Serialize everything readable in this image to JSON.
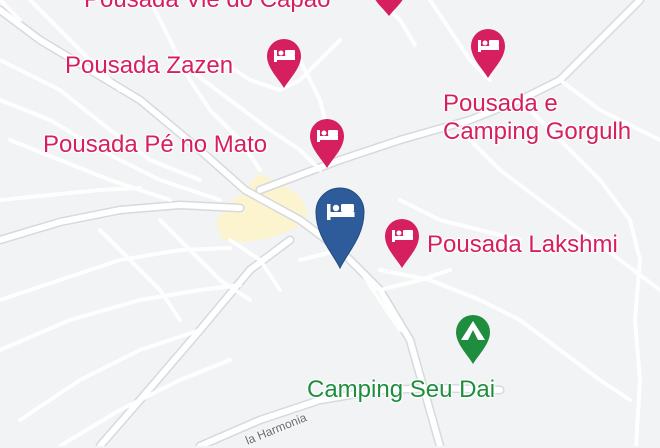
{
  "map": {
    "background": "#f1f3f4",
    "road_color": "#ffffff",
    "road_casing": "#d9dce0",
    "built_area": "#fbf4cf"
  },
  "pois": [
    {
      "id": "vie-do-capao",
      "label": "Pousada Vie do Capão",
      "icon": "hotel-bed-icon",
      "color": "#d61f5e"
    },
    {
      "id": "zazen",
      "label": "Pousada Zazen",
      "icon": "hotel-bed-icon",
      "color": "#d61f5e"
    },
    {
      "id": "gorgulho",
      "label_lines": [
        "Pousada e",
        "Camping Gorgulh"
      ],
      "icon": "hotel-bed-icon",
      "color": "#d61f5e"
    },
    {
      "id": "pe-no-mato",
      "label": "Pousada Pé no Mato",
      "icon": "hotel-bed-icon",
      "color": "#d61f5e"
    },
    {
      "id": "lakshmi",
      "label": "Pousada Lakshmi",
      "icon": "hotel-bed-icon",
      "color": "#d61f5e"
    },
    {
      "id": "seu-dai",
      "label": "Camping Seu Dai",
      "icon": "campground-tent-icon",
      "color": "#1e8e3e"
    }
  ],
  "selected_marker": {
    "icon": "hotel-bed-icon",
    "color": "#2e5c9a"
  },
  "streets": [
    {
      "label": "la Harmonia"
    }
  ]
}
